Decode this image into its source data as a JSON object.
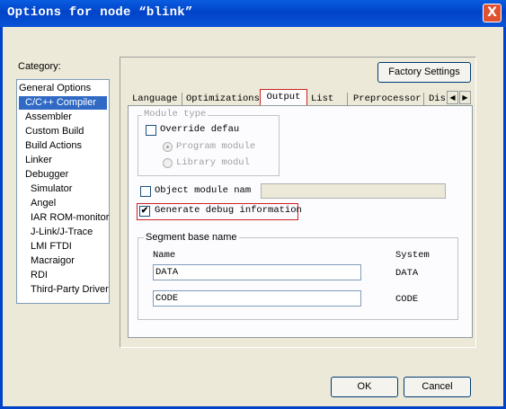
{
  "window": {
    "title": "Options for node “blink”"
  },
  "title_buttons": {
    "close": "X"
  },
  "category": {
    "label": "Category:",
    "items": [
      "General Options",
      "C/C++ Compiler",
      "Assembler",
      "Custom Build",
      "Build Actions",
      "Linker",
      "Debugger",
      "Simulator",
      "Angel",
      "IAR ROM-monitor",
      "J-Link/J-Trace",
      "LMI FTDI",
      "Macraigor",
      "RDI",
      "Third-Party Driver"
    ],
    "selected": "C/C++ Compiler"
  },
  "factory_settings": "Factory Settings",
  "tabs": [
    "Language",
    "Optimizations",
    "Output",
    "List",
    "Preprocessor",
    "Dis"
  ],
  "active_tab": "Output",
  "tab_scroll": {
    "left": "◀",
    "right": "▶"
  },
  "output": {
    "module_type": {
      "title": "Module type",
      "override_label": "Override defau",
      "override_checked": false,
      "program_module": "Program module",
      "library_module": "Library modul",
      "selected": "Program module"
    },
    "object_module": {
      "label": "Object module nam",
      "checked": false,
      "value": ""
    },
    "debug_info": {
      "label": "Generate debug information",
      "checked": true,
      "check_glyph": "✔"
    },
    "segment": {
      "title": "Segment base name",
      "col_name": "Name",
      "col_system": "System",
      "rows": [
        {
          "name": "DATA",
          "system": "DATA"
        },
        {
          "name": "CODE",
          "system": "CODE"
        }
      ]
    }
  },
  "buttons": {
    "ok": "OK",
    "cancel": "Cancel"
  }
}
